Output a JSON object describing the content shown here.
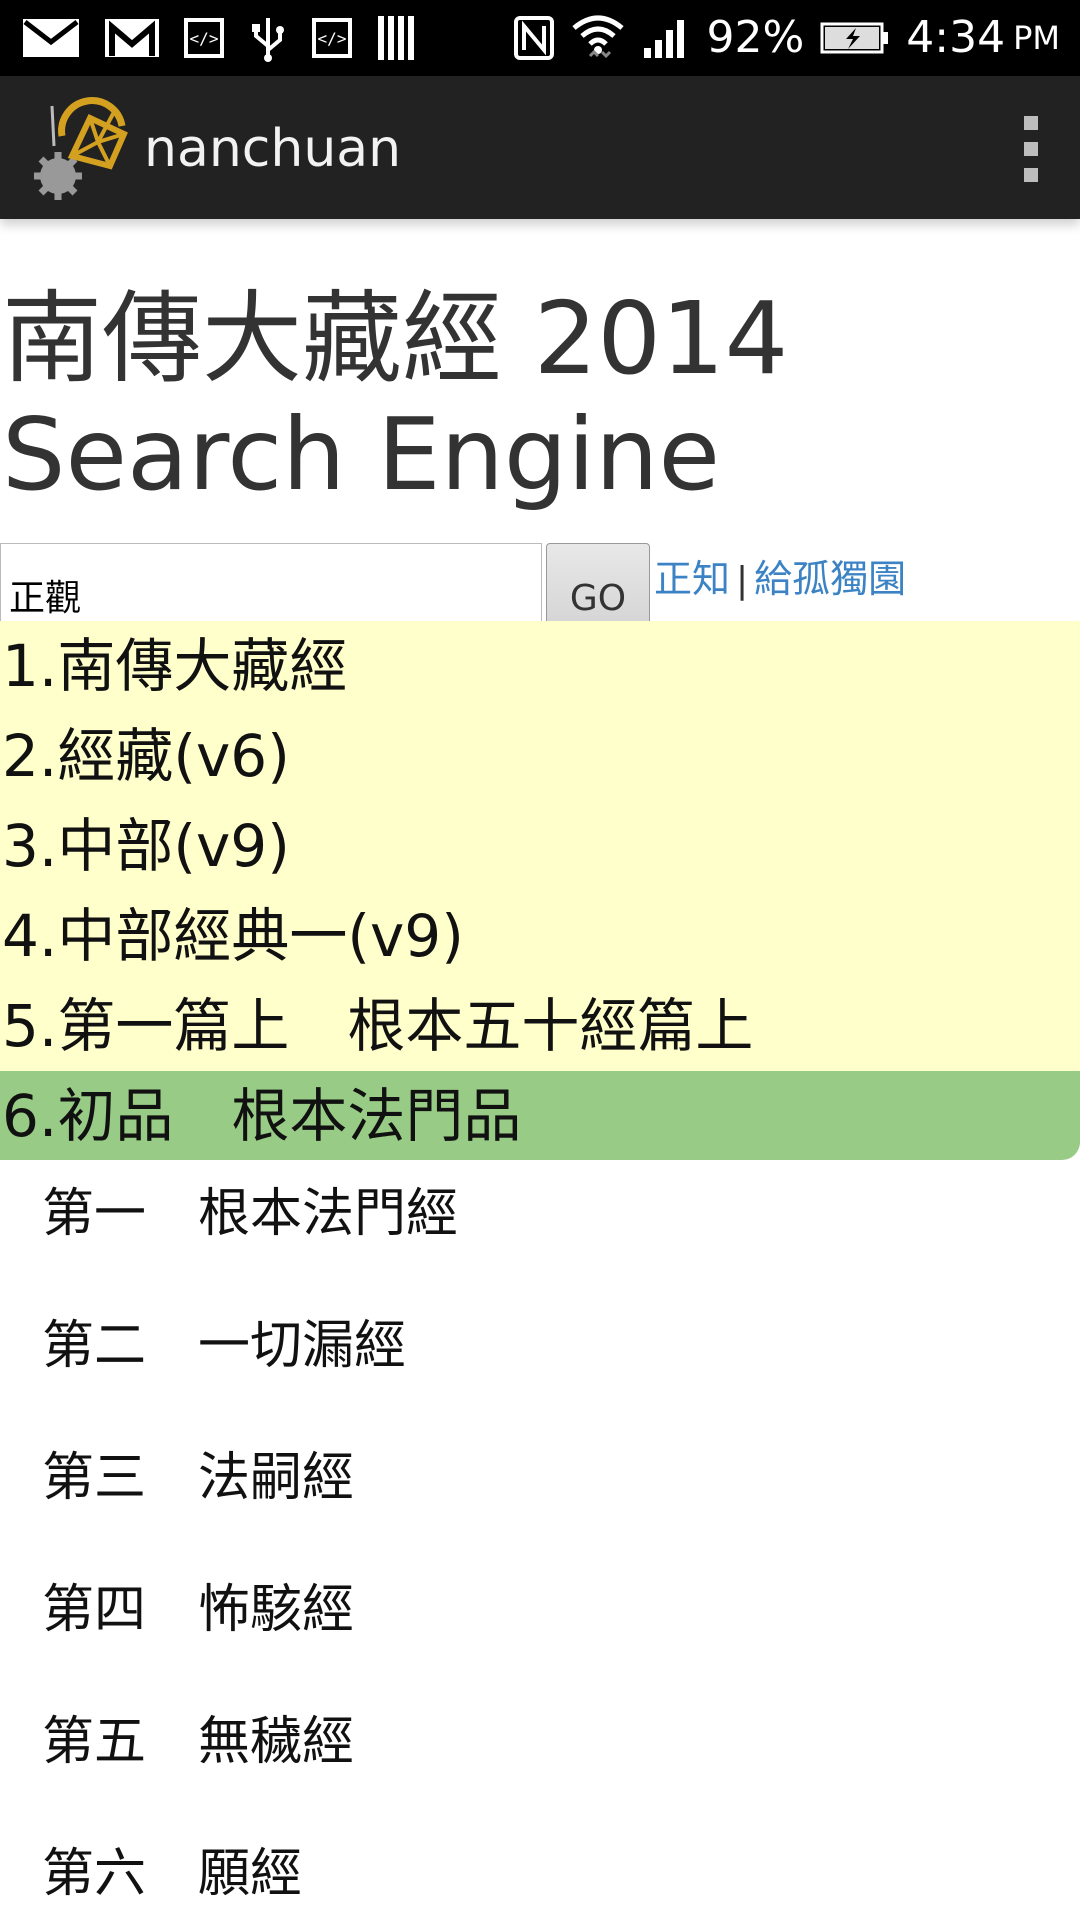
{
  "status_bar": {
    "icons": [
      "mail-icon",
      "gmail-icon",
      "code-icon",
      "usb-icon",
      "code-icon",
      "barcode-icon",
      "nfc-icon",
      "wifi-icon",
      "signal-icon",
      "battery-charging-icon"
    ],
    "battery": "92%",
    "time": "4:34",
    "ampm": "PM"
  },
  "app_bar": {
    "title": "nanchuan",
    "logo": "app-logo-icon",
    "menu": "overflow-menu-icon"
  },
  "page": {
    "title_line1": "南傳大藏經 2014",
    "title_line2": "Search Engine"
  },
  "search": {
    "value": "正觀",
    "go_label": "GO",
    "link1": "正知",
    "separator": "|",
    "link2": "給孤獨園"
  },
  "breadcrumbs": [
    "1.南傳大藏經",
    "2.經藏(v6)",
    "3.中部(v9)",
    "4.中部經典一(v9)",
    "5.第一篇上　根本五十經篇上"
  ],
  "active_crumb": "6.初品　根本法門品",
  "suttas": [
    "第一　根本法門經",
    "第二　一切漏經",
    "第三　法嗣經",
    "第四　怖駭經",
    "第五　無穢經",
    "第六　願經"
  ],
  "colors": {
    "crumb_bg": "#ffffcc",
    "active_bg": "#98cb85",
    "link": "#3b83c4",
    "app_bar": "#222222"
  }
}
